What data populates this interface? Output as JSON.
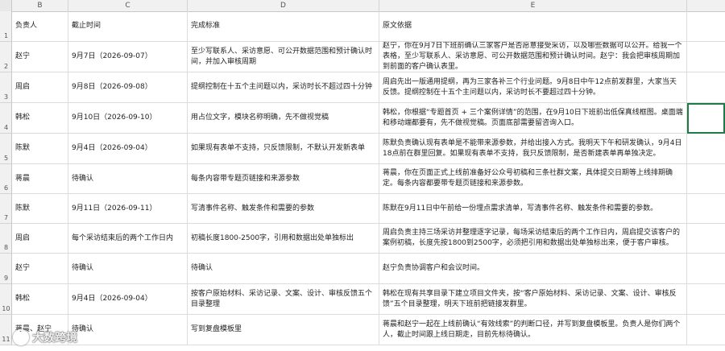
{
  "columns": [
    "B",
    "C",
    "D",
    "E"
  ],
  "header": {
    "owner": "负责人",
    "deadline": "截止时间",
    "standard": "完成标准",
    "basis": "原文依据"
  },
  "rows": [
    {
      "num": "2",
      "owner": "赵宁",
      "deadline": "9月7日（2026-09-07）",
      "standard": "至少写联系人、采访意愿、可公开数据范围和预计确认时间，并加入审核周期",
      "basis": "赵宁，你在9月7日下班前确认三家客户是否愿意接受采访，以及哪些数据可以公开。给我一个表格，至少写联系人、采访意愿、可公开数据范围和预计确认时间。赵宁：我会把审核周期加到前面的客户确认表里。"
    },
    {
      "num": "3",
      "owner": "周启",
      "deadline": "9月8日（2026-09-08）",
      "standard": "提纲控制在十五个主问题以内，采访时长不超过四十分钟",
      "basis": "周启先出一版通用提纲，再为三家各补三个行业问题。9月8日中午12点前发群里，大家当天反馈。提纲控制在十五个主问题以内，采访时长不要超过四十分钟。"
    },
    {
      "num": "4",
      "owner": "韩松",
      "deadline": "9月10日（2026-09-10）",
      "standard": "用占位文字，模块名称明确，先不做视觉稿",
      "basis": "韩松，你根据“专题首页 + 三个案例详情”的范围，在9月10日下班前出低保真线框图。桌面端和移动端都要有，先不做视觉稿。页面底部需要留咨询入口。"
    },
    {
      "num": "5",
      "owner": "陈默",
      "deadline": "9月4日（2026-09-04）",
      "standard": "如果现有表单不支持，只反馈限制，不默认开发新表单",
      "basis": "陈默负责确认现有表单是不能带来源参数，并给出接入方式。我明天下午和研发确认，9月4日18点前在群里回复。如果现有表单不支持，我只反馈限制，是否新建表单再单独决定。"
    },
    {
      "num": "6",
      "owner": "蒋晨",
      "deadline": "待确认",
      "standard": "每条内容带专题页链接和来源参数",
      "basis": "蒋晨，你在页面正式上线前准备好公众号初稿和三条社群文案，具体提交日期等上线排期确定。每条内容都要带专题页链接和来源参数。"
    },
    {
      "num": "7",
      "owner": "陈默",
      "deadline": "9月11日（2026-09-11）",
      "standard": "写清事件名称、触发条件和需要的参数",
      "basis": "陈默在9月11日中午前给一份埋点需求清单，写清事件名称、触发条件和需要的参数。"
    },
    {
      "num": "8",
      "owner": "周启",
      "deadline": "每个采访结束后的两个工作日内",
      "standard": "初稿长度1800-2500字，引用和数据出处单独标出",
      "basis": "周启负责主持三场采访并整理逐字记录，每场采访结束后的两个工作日内，周启提交该客户的案例初稿，长度先按1800到2500字，必须把引用和数据出处单独标出来，便于客户审核。"
    },
    {
      "num": "9",
      "owner": "赵宁",
      "deadline": "待确认",
      "standard": "待确认",
      "basis": "赵宁负责协调客户和会议时间。"
    },
    {
      "num": "10",
      "owner": "韩松",
      "deadline": "9月4日（2026-09-04）",
      "standard": "按客户原始材料、采访记录、文案、设计、审核反馈五个目录整理",
      "basis": "韩松在现有共享目录下建立项目文件夹，按“客户原始材料、采访记录、文案、设计、审核反馈”五个目录整理，明天下班前把链接发群里。"
    },
    {
      "num": "11",
      "owner": "蒋晨、赵宁",
      "deadline": "待确认",
      "standard": "写到复盘模板里",
      "basis": "蒋晨和赵宁一起在上线前确认“有效线索”的判断口径，并写到复盘模板里。负责人是你们两个人，截止时间跟上线日期走，目前先标待确认。"
    }
  ],
  "watermark": "大数跨境"
}
